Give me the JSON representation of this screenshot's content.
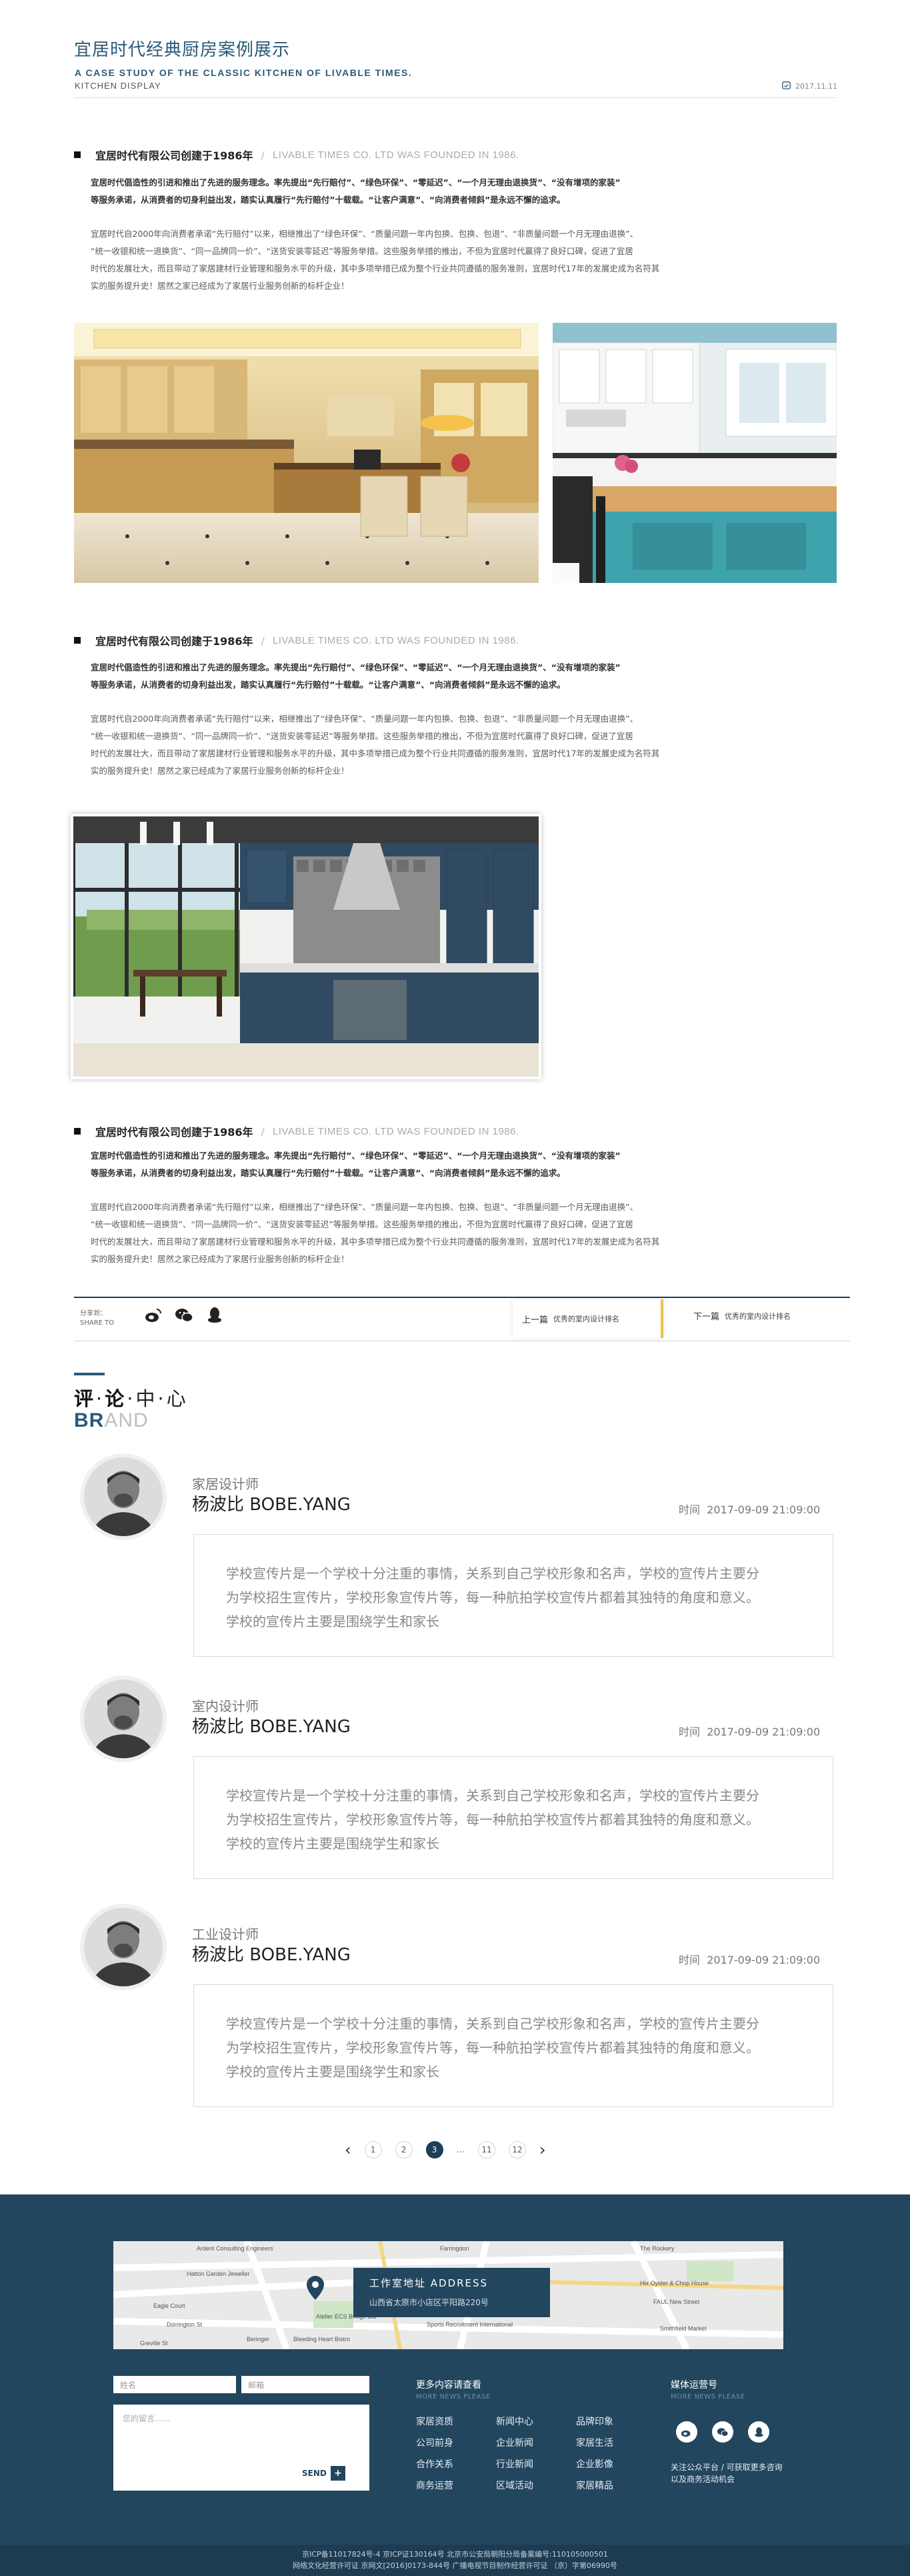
{
  "header": {
    "title": "宜居时代经典厨房案例展示",
    "subtitle_en": "A CASE STUDY OF THE CLASSIC KITCHEN OF LIVABLE TIMES.",
    "subtitle_en2": "KITCHEN DISPLAY",
    "date": "2017.11.11"
  },
  "sections": [
    {
      "heading_cn": "宜居时代有限公司创建于1986年",
      "heading_sep": "/",
      "heading_en": "LIVABLE TIMES CO. LTD WAS FOUNDED IN 1986.",
      "bold_lines": [
        "宜居时代倡造性的引进和推出了先进的服务理念。率先提出“先行赔付”、“绿色环保”、“零延迟”、“一个月无理由退换货”、“没有增项的家装”",
        "等服务承诺，从消费者的切身利益出发，踏实认真履行“先行赔付”十载载。“让客户满意”、“向消费者倾斜”是永远不懈的追求。"
      ],
      "light_lines": [
        "宜居时代自2000年向消费者承诺“先行赔付”以来，相继推出了“绿色环保”、“质量问题一年内包换、包换、包退”、“非质量问题一个月无理由退换”、",
        "“统一收银和统一退换货”、“同一品牌同一价”、“送货安装零延迟”等服务举措。这些服务举措的推出，不但为宜居时代赢得了良好口碑，促进了宜居",
        "时代的发展壮大，而且带动了家居建材行业管理和服务水平的升级，其中多项举措已成为整个行业共同遵循的服务准则，宜居时代17年的发展史成为名符其",
        "实的服务提升史！居然之家已经成为了家居行业服务创新的标杆企业！"
      ]
    },
    {
      "heading_cn": "宜居时代有限公司创建于1986年",
      "heading_sep": "/",
      "heading_en": "LIVABLE TIMES CO. LTD WAS FOUNDED IN 1986.",
      "bold_lines": [
        "宜居时代倡造性的引进和推出了先进的服务理念。率先提出“先行赔付”、“绿色环保”、“零延迟”、“一个月无理由退换货”、“没有增项的家装”",
        "等服务承诺，从消费者的切身利益出发，踏实认真履行“先行赔付”十载载。“让客户满意”、“向消费者倾斜”是永远不懈的追求。"
      ],
      "light_lines": [
        "宜居时代自2000年向消费者承诺“先行赔付”以来，相继推出了“绿色环保”、“质量问题一年内包换、包换、包退”、“非质量问题一个月无理由退换”、",
        "“统一收银和统一退换货”、“同一品牌同一价”、“送货安装零延迟”等服务举措。这些服务举措的推出，不但为宜居时代赢得了良好口碑，促进了宜居",
        "时代的发展壮大，而且带动了家居建材行业管理和服务水平的升级，其中多项举措已成为整个行业共同遵循的服务准则，宜居时代17年的发展史成为名符其",
        "实的服务提升史！居然之家已经成为了家居行业服务创新的标杆企业！"
      ]
    },
    {
      "heading_cn": "宜居时代有限公司创建于1986年",
      "heading_sep": "/",
      "heading_en": "LIVABLE TIMES CO. LTD WAS FOUNDED IN 1986.",
      "bold_lines": [
        "宜居时代倡造性的引进和推出了先进的服务理念。率先提出“先行赔付”、“绿色环保”、“零延迟”、“一个月无理由退换货”、“没有增项的家装”",
        "等服务承诺，从消费者的切身利益出发，踏实认真履行“先行赔付”十载载。“让客户满意”、“向消费者倾斜”是永远不懈的追求。"
      ],
      "light_lines": [
        "宜居时代自2000年向消费者承诺“先行赔付”以来，相继推出了“绿色环保”、“质量问题一年内包换、包换、包退”、“非质量问题一个月无理由退换”、",
        "“统一收银和统一退换货”、“同一品牌同一价”、“送货安装零延迟”等服务举措。这些服务举措的推出，不但为宜居时代赢得了良好口碑，促进了宜居",
        "时代的发展壮大，而且带动了家居建材行业管理和服务水平的升级，其中多项举措已成为整个行业共同遵循的服务准则，宜居时代17年的发展史成为名符其",
        "实的服务提升史！居然之家已经成为了家居行业服务创新的标杆企业！"
      ]
    }
  ],
  "share": {
    "label_cn": "分享到：",
    "label_en": "SHARE TO",
    "icons": [
      "weibo-icon",
      "wechat-icon",
      "qq-icon"
    ],
    "prev_label": "上一篇",
    "prev_title": "优秀的室内设计排名",
    "next_label": "下一篇",
    "next_title": "优秀的室内设计排名"
  },
  "comments_section": {
    "title_chars": [
      "评",
      "论",
      "中",
      "心"
    ],
    "brand_bold": "BR",
    "brand_light": "AND",
    "time_label": "时间",
    "items": [
      {
        "role": "家居设计师",
        "name": "杨波比 BOBE.YANG",
        "time": "2017-09-09 21:09:00",
        "lines": [
          "学校宣传片是一个学校十分注重的事情，关系到自己学校形象和名声，学校的宣传片主要分",
          "为学校招生宣传片，学校形象宣传片等，每一种航拍学校宣传片都着其独特的角度和意义。",
          "学校的宣传片主要是围绕学生和家长"
        ]
      },
      {
        "role": "室内设计师",
        "name": "杨波比 BOBE.YANG",
        "time": "2017-09-09 21:09:00",
        "lines": [
          "学校宣传片是一个学校十分注重的事情，关系到自己学校形象和名声，学校的宣传片主要分",
          "为学校招生宣传片，学校形象宣传片等，每一种航拍学校宣传片都着其独特的角度和意义。",
          "学校的宣传片主要是围绕学生和家长"
        ]
      },
      {
        "role": "工业设计师",
        "name": "杨波比 BOBE.YANG",
        "time": "2017-09-09 21:09:00",
        "lines": [
          "学校宣传片是一个学校十分注重的事情，关系到自己学校形象和名声，学校的宣传片主要分",
          "为学校招生宣传片，学校形象宣传片等，每一种航拍学校宣传片都着其独特的角度和意义。",
          "学校的宣传片主要是围绕学生和家长"
        ]
      }
    ]
  },
  "pagination": {
    "prev": "‹",
    "pages": [
      "1",
      "2",
      "3"
    ],
    "active": "3",
    "dots": "...",
    "tail_pages": [
      "11",
      "12"
    ],
    "next": "›"
  },
  "footer": {
    "map_labels": [
      "Ardent Consulting Engineers",
      "Farringdon",
      "The Rookery",
      "Hatton Garden Jeweller",
      "Hix Oyster & Chop House",
      "Clerkenwell",
      "Eagle Court",
      "Charterhouse",
      "FAUL New Street",
      "Dorrington St",
      "Atelier ECS Bridge Bar",
      "Smithfield Market",
      "Sports Recruitment International",
      "Beringer",
      "Bleeding Heart Bistro",
      "Greville St",
      "Saffron Hill",
      "Charterhouse St",
      "Farringdon Rd"
    ],
    "address_title": "工作室地址 ADDRESS",
    "address": "山西省太原市小店区平阳路220号",
    "name_placeholder": "姓名",
    "email_placeholder": "邮箱",
    "message_placeholder": "您的留言......",
    "send_label": "SEND",
    "links_title": "更多内容请查看",
    "links_sub": "MORE NEWS PLEASE",
    "links": [
      "家居资质",
      "新闻中心",
      "品牌印象",
      "公司前身",
      "企业新闻",
      "家居生活",
      "合作关系",
      "行业新闻",
      "企业影像",
      "商务运营",
      "区域活动",
      "家居精品"
    ],
    "media_title": "媒体运营号",
    "media_sub": "MORE NEWS PLEASE",
    "media_icons": [
      "weibo-icon",
      "wechat-icon",
      "qq-icon"
    ],
    "media_note_1": "关注公众平台 / 可获取更多咨询",
    "media_note_2": "以及商务活动机会",
    "copyright_1": "京ICP备11017824号-4 京ICP证130164号 北京市公安局朝阳分局备案编号:110105000501",
    "copyright_2": "网络文化经营许可证 京网文[2016]0173-844号 广播电视节目制作经营许可证 （京）字第06990号"
  }
}
